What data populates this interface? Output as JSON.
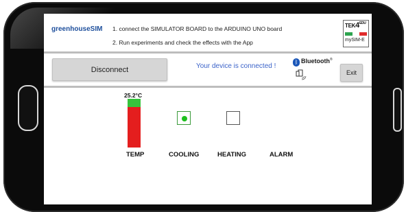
{
  "app": {
    "name": "greenhouseSIM",
    "instructions": [
      "1. connect the SIMULATOR BOARD to the ARDUINO UNO board",
      "2. Run experiments and check the effects with the App"
    ]
  },
  "logo": {
    "brand": "TEK4EDU",
    "product": "mySIM-E",
    "flag_colors": [
      "#2ea44f",
      "#ffffff",
      "#e02b2b"
    ]
  },
  "controls": {
    "disconnect_label": "Disconnect",
    "exit_label": "Exit"
  },
  "connection": {
    "status_text": "Your device is connected !",
    "bluetooth_label": "Bluetooth",
    "bluetooth_icon": "bluetooth-icon",
    "device_icon": "phone-connected-icon"
  },
  "sensors": {
    "temperature": {
      "value": "25.2°C",
      "label": "TEMP",
      "level_fraction": 0.17
    },
    "cooling": {
      "label": "COOLING",
      "active": true
    },
    "heating": {
      "label": "HEATING",
      "active": false
    },
    "alarm": {
      "label": "ALARM",
      "active": false
    }
  },
  "colors": {
    "app_name": "#1e4f9c",
    "status_text": "#3b63c9",
    "thermo_hot": "#e41e1e",
    "thermo_fill": "#36c43c",
    "led_on": "#1ec01e"
  }
}
